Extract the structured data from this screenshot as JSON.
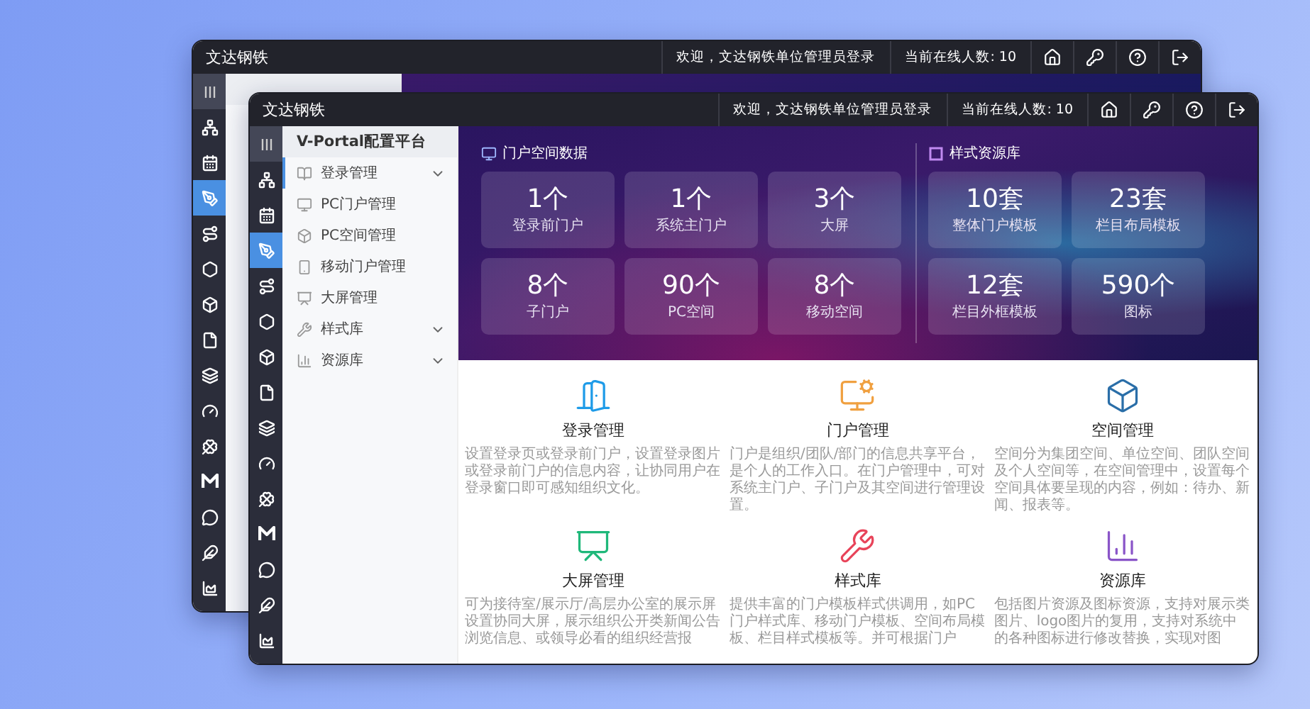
{
  "windows": [
    {
      "title": "文达钢铁",
      "welcome": "欢迎，文达钢铁单位管理员登录",
      "online": "当前在线人数: 10",
      "rail": [
        {
          "selected": false
        },
        {
          "selected": false
        },
        {
          "selected": false
        },
        {
          "selected": true
        },
        {
          "selected": false
        },
        {
          "selected": false
        },
        {
          "selected": false
        },
        {
          "selected": false
        },
        {
          "selected": false
        },
        {
          "selected": false
        },
        {
          "selected": false
        },
        {
          "selected": false
        },
        {
          "selected": false
        },
        {
          "selected": false
        },
        {
          "selected": false
        }
      ]
    },
    {
      "title": "文达钢铁",
      "welcome": "欢迎，文达钢铁单位管理员登录",
      "online": "当前在线人数: 10",
      "rail": [
        {
          "selected": false
        },
        {
          "selected": false
        },
        {
          "selected": false
        },
        {
          "selected": true
        },
        {
          "selected": false
        },
        {
          "selected": false
        },
        {
          "selected": false
        },
        {
          "selected": false
        },
        {
          "selected": false
        },
        {
          "selected": false
        },
        {
          "selected": false
        },
        {
          "selected": false
        },
        {
          "selected": false
        },
        {
          "selected": false
        },
        {
          "selected": false
        }
      ],
      "sidebar": {
        "heading": "V-Portal配置平台",
        "items": [
          {
            "label": "登录管理",
            "kind": "group",
            "selected": true
          },
          {
            "label": "PC门户管理",
            "kind": "item",
            "selected": false
          },
          {
            "label": "PC空间管理",
            "kind": "item",
            "selected": false
          },
          {
            "label": "移动门户管理",
            "kind": "item",
            "selected": false
          },
          {
            "label": "大屏管理",
            "kind": "item",
            "selected": false
          },
          {
            "label": "样式库",
            "kind": "group",
            "selected": false
          },
          {
            "label": "资源库",
            "kind": "group",
            "selected": false
          }
        ]
      },
      "stats": [
        {
          "heading": "门户空间数据",
          "tiles": [
            {
              "value": "1个",
              "label": "登录前门户"
            },
            {
              "value": "1个",
              "label": "系统主门户"
            },
            {
              "value": "3个",
              "label": "大屏"
            },
            {
              "value": "8个",
              "label": "子门户"
            },
            {
              "value": "90个",
              "label": "PC空间"
            },
            {
              "value": "8个",
              "label": "移动空间"
            }
          ]
        },
        {
          "heading": "样式资源库",
          "tiles": [
            {
              "value": "10套",
              "label": "整体门户模板"
            },
            {
              "value": "23套",
              "label": "栏目布局模板"
            },
            {
              "value": "12套",
              "label": "栏目外框模板"
            },
            {
              "value": "590个",
              "label": "图标"
            }
          ]
        }
      ],
      "features": [
        {
          "title": "登录管理",
          "color": "#1e9be8",
          "desc": "设置登录页或登录前门户，设置登录图片或登录前门户的信息内容，让协同用户在登录窗口即可感知组织文化。"
        },
        {
          "title": "门户管理",
          "color": "#f0a040",
          "desc": "门户是组织/团队/部门的信息共享平台，是个人的工作入口。在门户管理中，可对系统主门户、子门户及其空间进行管理设置。"
        },
        {
          "title": "空间管理",
          "color": "#2a6ea8",
          "desc": "空间分为集团空间、单位空间、团队空间及个人空间等，在空间管理中，设置每个空间具体要呈现的内容，例如：待办、新闻、报表等。"
        },
        {
          "title": "大屏管理",
          "color": "#1fb87a",
          "desc": "可为接待室/展示厅/高层办公室的展示屏设置协同大屏，展示组织公开类新闻公告浏览信息、或领导必看的组织经营报"
        },
        {
          "title": "样式库",
          "color": "#e8445a",
          "desc": "提供丰富的门户模板样式供调用，如PC门户样式库、移动门户模板、空间布局模板、栏目样式模板等。并可根据门户"
        },
        {
          "title": "资源库",
          "color": "#8a55c8",
          "desc": "包括图片资源及图标资源，支持对展示类图片、logo图片的复用，支持对系统中的各种图标进行修改替换，实现对图"
        }
      ]
    }
  ]
}
